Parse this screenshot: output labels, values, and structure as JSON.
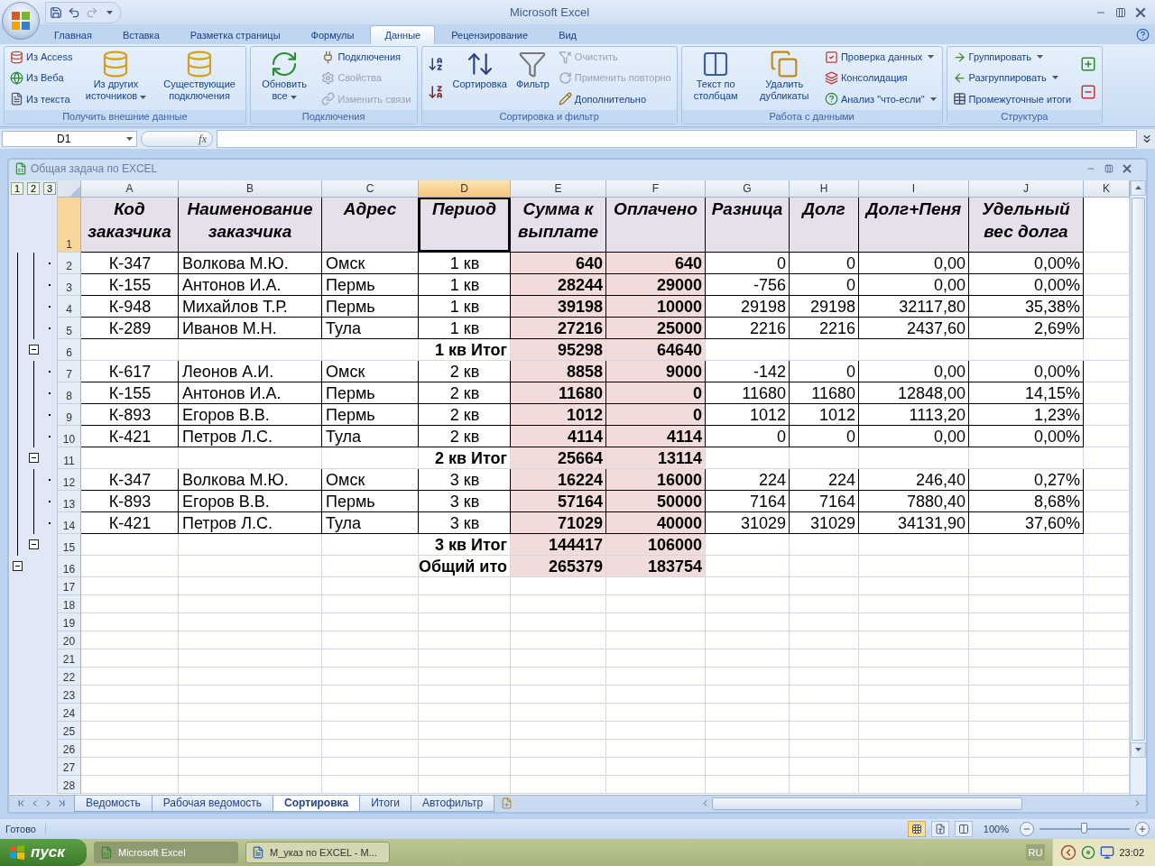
{
  "window": {
    "title": "Microsoft Excel"
  },
  "tabs": [
    {
      "label": "Главная",
      "selected": false
    },
    {
      "label": "Вставка",
      "selected": false
    },
    {
      "label": "Разметка страницы",
      "selected": false
    },
    {
      "label": "Формулы",
      "selected": false
    },
    {
      "label": "Данные",
      "selected": true
    },
    {
      "label": "Рецензирование",
      "selected": false
    },
    {
      "label": "Вид",
      "selected": false
    }
  ],
  "ribbon": [
    {
      "name": "Получить внешние данные",
      "columns": [
        {
          "kind": "stack",
          "items": [
            {
              "label": "Из Access",
              "disabled": false,
              "dropdown": false
            },
            {
              "label": "Из Веба",
              "disabled": false,
              "dropdown": false
            },
            {
              "label": "Из текста",
              "disabled": false,
              "dropdown": false
            }
          ]
        },
        {
          "kind": "large",
          "label": "Из других источников",
          "dropdown": true
        },
        {
          "kind": "large",
          "label": "Существующие подключения",
          "dropdown": false
        }
      ]
    },
    {
      "name": "Подключения",
      "columns": [
        {
          "kind": "large",
          "label": "Обновить все",
          "dropdown": true
        },
        {
          "kind": "stack",
          "items": [
            {
              "label": "Подключения",
              "disabled": false,
              "dropdown": false
            },
            {
              "label": "Свойства",
              "disabled": true,
              "dropdown": false
            },
            {
              "label": "Изменить связи",
              "disabled": true,
              "dropdown": false
            }
          ]
        }
      ]
    },
    {
      "name": "Сортировка и фильтр",
      "columns": [
        {
          "kind": "sort-buttons"
        },
        {
          "kind": "large",
          "label": "Сортировка",
          "dropdown": false
        },
        {
          "kind": "large",
          "label": "Фильтр",
          "dropdown": false
        },
        {
          "kind": "stack",
          "items": [
            {
              "label": "Очистить",
              "disabled": true,
              "dropdown": false
            },
            {
              "label": "Применить повторно",
              "disabled": true,
              "dropdown": false
            },
            {
              "label": "Дополнительно",
              "disabled": false,
              "dropdown": false
            }
          ]
        }
      ]
    },
    {
      "name": "Работа с данными",
      "columns": [
        {
          "kind": "large",
          "label": "Текст по столбцам",
          "dropdown": false
        },
        {
          "kind": "large",
          "label": "Удалить дубликаты",
          "dropdown": false
        },
        {
          "kind": "stack",
          "items": [
            {
              "label": "Проверка данных",
              "disabled": false,
              "dropdown": true
            },
            {
              "label": "Консолидация",
              "disabled": false,
              "dropdown": false
            },
            {
              "label": "Анализ \"что-если\"",
              "disabled": false,
              "dropdown": true
            }
          ]
        }
      ]
    },
    {
      "name": "Структура",
      "columns": [
        {
          "kind": "stack",
          "items": [
            {
              "label": "Группировать",
              "disabled": false,
              "dropdown": true
            },
            {
              "label": "Разгруппировать",
              "disabled": false,
              "dropdown": true
            },
            {
              "label": "Промежуточные итоги",
              "disabled": false,
              "dropdown": false
            }
          ]
        },
        {
          "kind": "detail-buttons"
        }
      ]
    }
  ],
  "formula_bar": {
    "name_box": "D1",
    "function_button": "fx"
  },
  "workbook": {
    "title": "Общая задача по EXCEL"
  },
  "sheet": {
    "outline_levels": [
      "1",
      "2",
      "3"
    ],
    "columns": [
      {
        "letter": "A",
        "selected": false
      },
      {
        "letter": "B",
        "selected": false
      },
      {
        "letter": "C",
        "selected": false
      },
      {
        "letter": "D",
        "selected": true
      },
      {
        "letter": "E",
        "selected": false
      },
      {
        "letter": "F",
        "selected": false
      },
      {
        "letter": "G",
        "selected": false
      },
      {
        "letter": "H",
        "selected": false
      },
      {
        "letter": "I",
        "selected": false
      },
      {
        "letter": "J",
        "selected": false
      },
      {
        "letter": "K",
        "selected": false
      }
    ],
    "rows": [
      {
        "number": "1",
        "kind": "header",
        "selected": true,
        "cells": [
          "Код заказчика",
          "Наименование заказчика",
          "Адрес",
          "Период",
          "Сумма к выплате",
          "Оплачено",
          "Разница",
          "Долг",
          "Долг+Пеня",
          "Удельный вес долга"
        ]
      },
      {
        "number": "2",
        "kind": "data",
        "selected": false,
        "cells": [
          "К-347",
          "Волкова М.Ю.",
          "Омск",
          "1 кв",
          "640",
          "640",
          "0",
          "0",
          "0,00",
          "0,00%"
        ]
      },
      {
        "number": "3",
        "kind": "data",
        "selected": false,
        "cells": [
          "К-155",
          "Антонов И.А.",
          "Пермь",
          "1 кв",
          "28244",
          "29000",
          "-756",
          "0",
          "0,00",
          "0,00%"
        ]
      },
      {
        "number": "4",
        "kind": "data",
        "selected": false,
        "cells": [
          "К-948",
          "Михайлов Т.Р.",
          "Пермь",
          "1 кв",
          "39198",
          "10000",
          "29198",
          "29198",
          "32117,80",
          "35,38%"
        ]
      },
      {
        "number": "5",
        "kind": "data",
        "selected": false,
        "cells": [
          "К-289",
          "Иванов М.Н.",
          "Тула",
          "1 кв",
          "27216",
          "25000",
          "2216",
          "2216",
          "2437,60",
          "2,69%"
        ]
      },
      {
        "number": "6",
        "kind": "subtotal",
        "selected": false,
        "label": "1 кв Итог",
        "sum": "95298",
        "paid": "64640"
      },
      {
        "number": "7",
        "kind": "data",
        "selected": false,
        "cells": [
          "К-617",
          "Леонов А.И.",
          "Омск",
          "2 кв",
          "8858",
          "9000",
          "-142",
          "0",
          "0,00",
          "0,00%"
        ]
      },
      {
        "number": "8",
        "kind": "data",
        "selected": false,
        "cells": [
          "К-155",
          "Антонов И.А.",
          "Пермь",
          "2 кв",
          "11680",
          "0",
          "11680",
          "11680",
          "12848,00",
          "14,15%"
        ]
      },
      {
        "number": "9",
        "kind": "data",
        "selected": false,
        "cells": [
          "К-893",
          "Егоров В.В.",
          "Пермь",
          "2 кв",
          "1012",
          "0",
          "1012",
          "1012",
          "1113,20",
          "1,23%"
        ]
      },
      {
        "number": "10",
        "kind": "data",
        "selected": false,
        "cells": [
          "К-421",
          "Петров Л.С.",
          "Тула",
          "2 кв",
          "4114",
          "4114",
          "0",
          "0",
          "0,00",
          "0,00%"
        ]
      },
      {
        "number": "11",
        "kind": "subtotal",
        "selected": false,
        "label": "2 кв Итог",
        "sum": "25664",
        "paid": "13114"
      },
      {
        "number": "12",
        "kind": "data",
        "selected": false,
        "cells": [
          "К-347",
          "Волкова М.Ю.",
          "Омск",
          "3 кв",
          "16224",
          "16000",
          "224",
          "224",
          "246,40",
          "0,27%"
        ]
      },
      {
        "number": "13",
        "kind": "data",
        "selected": false,
        "cells": [
          "К-893",
          "Егоров В.В.",
          "Пермь",
          "3 кв",
          "57164",
          "50000",
          "7164",
          "7164",
          "7880,40",
          "8,68%"
        ]
      },
      {
        "number": "14",
        "kind": "data",
        "selected": false,
        "cells": [
          "К-421",
          "Петров Л.С.",
          "Тула",
          "3 кв",
          "71029",
          "40000",
          "31029",
          "31029",
          "34131,90",
          "37,60%"
        ]
      },
      {
        "number": "15",
        "kind": "subtotal",
        "selected": false,
        "label": "3 кв Итог",
        "sum": "144417",
        "paid": "106000"
      },
      {
        "number": "16",
        "kind": "total",
        "selected": false,
        "label": "Общий ито",
        "sum": "265379",
        "paid": "183754"
      },
      {
        "number": "17",
        "kind": "blank",
        "selected": false
      },
      {
        "number": "18",
        "kind": "blank",
        "selected": false
      },
      {
        "number": "19",
        "kind": "blank",
        "selected": false
      },
      {
        "number": "20",
        "kind": "blank",
        "selected": false
      },
      {
        "number": "21",
        "kind": "blank",
        "selected": false
      },
      {
        "number": "22",
        "kind": "blank",
        "selected": false
      },
      {
        "number": "23",
        "kind": "blank",
        "selected": false
      },
      {
        "number": "24",
        "kind": "blank",
        "selected": false
      },
      {
        "number": "25",
        "kind": "blank",
        "selected": false
      },
      {
        "number": "26",
        "kind": "blank",
        "selected": false
      },
      {
        "number": "27",
        "kind": "blank",
        "selected": false
      },
      {
        "number": "28",
        "kind": "blank",
        "selected": false
      }
    ]
  },
  "sheet_tabs": [
    {
      "label": "Ведомость",
      "selected": false
    },
    {
      "label": "Рабочая ведомость",
      "selected": false
    },
    {
      "label": "Сортировка",
      "selected": true
    },
    {
      "label": "Итоги",
      "selected": false
    },
    {
      "label": "Автофильтр",
      "selected": false
    }
  ],
  "status_bar": {
    "text": "Готово",
    "views": [
      {
        "selected": true
      },
      {
        "selected": false
      },
      {
        "selected": false
      }
    ],
    "zoom": {
      "label": "100%",
      "level": 0.5
    }
  },
  "taskbar": {
    "start": "пуск",
    "tasks": [
      {
        "label": "Microsoft Excel",
        "selected": true
      },
      {
        "label": "М_указ по EXCEL - М...",
        "selected": false
      }
    ],
    "language": "RU",
    "clock": "23:02"
  }
}
